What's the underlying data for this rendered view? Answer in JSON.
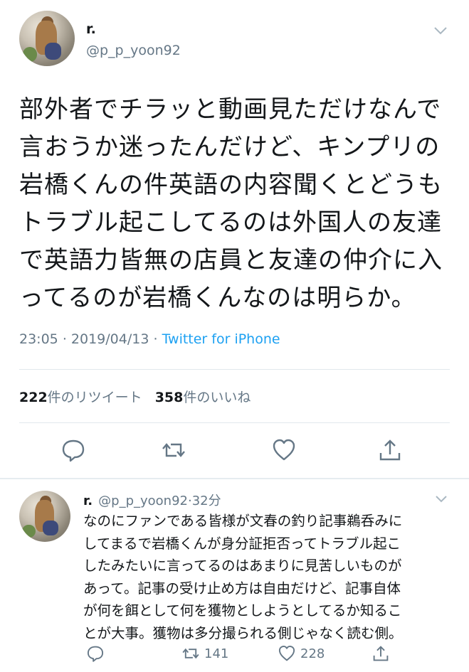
{
  "tweet": {
    "user_name": "r.",
    "user_handle": "@p_p_yoon92",
    "text_lines": [
      "部外者でチラッと動画見ただけなんで",
      "言おうか迷ったんだけど、キンプリの",
      "岩橋くんの件英語の内容聞くとどうも",
      "トラブル起こしてるのは外国人の友達",
      "で英語力皆無の店員と友達の仲介に入",
      "ってるのが岩橋くんなのは明らか。"
    ],
    "time": "23:05",
    "date": "2019/04/13",
    "source": "Twitter for iPhone",
    "retweet_count": "222",
    "retweet_label": "件のリツイート",
    "like_count": "358",
    "like_label": "件のいいね",
    "actions": [
      "reply-icon",
      "retweet-icon",
      "like-icon",
      "share-icon"
    ]
  },
  "reply": {
    "user_name": "r.",
    "user_handle": "@p_p_yoon92",
    "separator": "·",
    "time_ago": "32分",
    "text_lines": [
      "なのにファンである皆様が文春の釣り記事鵜呑みに",
      "してまるで岩橋くんが身分証拒否ってトラブル起こ",
      "したみたいに言ってるのはあまりに見苦しいものが",
      "あって。記事の受け止め方は自由だけど、記事自体",
      "が何を餌として何を獲物としようとしてるか知るこ",
      "とが大事。獲物は多分撮られる側じゃなく読む側。"
    ],
    "retweets": "141",
    "likes": "228"
  },
  "colors": {
    "text": "#14171a",
    "secondary": "#657786",
    "link": "#1da1f2",
    "divider": "#e1e8ed"
  }
}
